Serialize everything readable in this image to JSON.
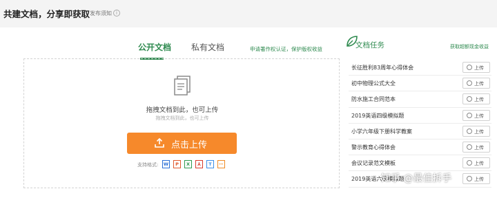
{
  "header": {
    "title": "共建文档，分享即获取",
    "notice_link": "发布须知",
    "info_icon": "info-icon"
  },
  "tabs": [
    {
      "label": "公开文档",
      "active": true
    },
    {
      "label": "私有文档",
      "active": false
    }
  ],
  "copyright_link": "申请著作权认证，保护版权收益",
  "dropzone": {
    "icon": "document-icon",
    "main_text": "拖拽文档到此，也可上传",
    "sub_text": "拖拽文档到此，也可上传",
    "upload_button": "点击上传",
    "upload_icon": "upload-arrow-icon",
    "formats_label": "支持格式:",
    "formats": [
      {
        "letter": "W",
        "color": "#2b6fd6"
      },
      {
        "letter": "P",
        "color": "#e0582c"
      },
      {
        "letter": "X",
        "color": "#2e9a4f"
      },
      {
        "letter": "⅄",
        "color": "#d93a2b"
      },
      {
        "letter": "T",
        "color": "#3b8ee8"
      },
      {
        "letter": "⋯",
        "color": "#f08a24"
      }
    ]
  },
  "task_panel": {
    "title": "文档任务",
    "logo_icon": "task-leaf-icon",
    "reward_link": "获取超额现金收益",
    "items": [
      {
        "name": "长征胜利83周年心得体会",
        "button": "上传"
      },
      {
        "name": "初中物理公式大全",
        "button": "上传"
      },
      {
        "name": "防水施工合同范本",
        "button": "上传"
      },
      {
        "name": "2019英语四级模拟题",
        "button": "上传"
      },
      {
        "name": "小学六年级下册科学教案",
        "button": "上传"
      },
      {
        "name": "警示教育心得体会",
        "button": "上传"
      },
      {
        "name": "会议记录范文模板",
        "button": "上传"
      },
      {
        "name": "2019英语六级模拟题",
        "button": "上传"
      }
    ]
  },
  "watermark": "知乎 @最佳拆手",
  "colors": {
    "accent": "#2e8a4f",
    "upload": "#f6892b"
  }
}
